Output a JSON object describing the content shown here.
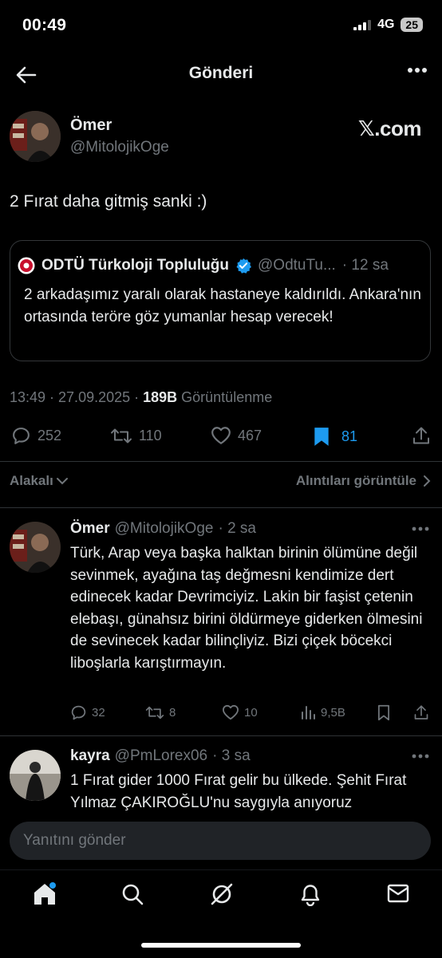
{
  "status_bar": {
    "time": "00:49",
    "network": "4G",
    "battery": "25"
  },
  "header": {
    "title": "Gönderi"
  },
  "post": {
    "author_name": "Ömer",
    "author_handle": "@MitolojikOge",
    "x_logo": "𝕏.com",
    "text": "2 Fırat daha gitmiş sanki :)",
    "quote": {
      "name": "ODTÜ Türkoloji Topluluğu",
      "handle": "@OdtuTu...",
      "time": "· 12 sa",
      "text": "2 arkadaşımız yaralı olarak hastaneye kaldırıldı. Ankara'nın ortasında teröre göz yumanlar hesap verecek!"
    },
    "timestamp": "13:49 · 27.09.2025 · ",
    "views_count": "189B",
    "views_label": " Görüntülenme",
    "replies": "252",
    "reposts": "110",
    "likes": "467",
    "bookmarks": "81"
  },
  "sort": {
    "label": "Alakalı",
    "quotes_link": "Alıntıları görüntüle"
  },
  "replies": [
    {
      "name": "Ömer",
      "handle": "@MitolojikOge",
      "time": "· 2 sa",
      "text": "Türk, Arap veya başka halktan birinin ölümüne değil sevinmek, ayağına taş değmesni kendimize dert edinecek kadar Devrimciyiz. Lakin bir faşist çetenin elebaşı, günahsız birini öldürmeye giderken ölmesini de sevinecek kadar bilinçliyiz. Bizi çiçek böcekci liboşlarla karıştırmayın.",
      "replies": "32",
      "reposts": "8",
      "likes": "10",
      "views": "9,5B"
    },
    {
      "name": "kayra",
      "handle": "@PmLorex06",
      "time": "· 3 sa",
      "text": "1 Fırat gider 1000 Fırat gelir bu ülkede. Şehit Fırat Yılmaz ÇAKIROĞLU'nu saygıyla anıyoruz"
    }
  ],
  "reply_box": {
    "placeholder": "Yanıtını gönder"
  },
  "colors": {
    "accent": "#1d9bf0",
    "muted": "#71767b",
    "text": "#e7e9ea",
    "background": "#000000",
    "verified": "#1d9bf0",
    "notification_dot": "#1d9bf0"
  },
  "icons": [
    "back-arrow-icon",
    "more-icon",
    "verified-icon",
    "reply-icon",
    "repost-icon",
    "like-icon",
    "bookmark-icon",
    "share-icon",
    "views-icon",
    "home-icon",
    "search-icon",
    "grok-icon",
    "notifications-icon",
    "messages-icon"
  ]
}
